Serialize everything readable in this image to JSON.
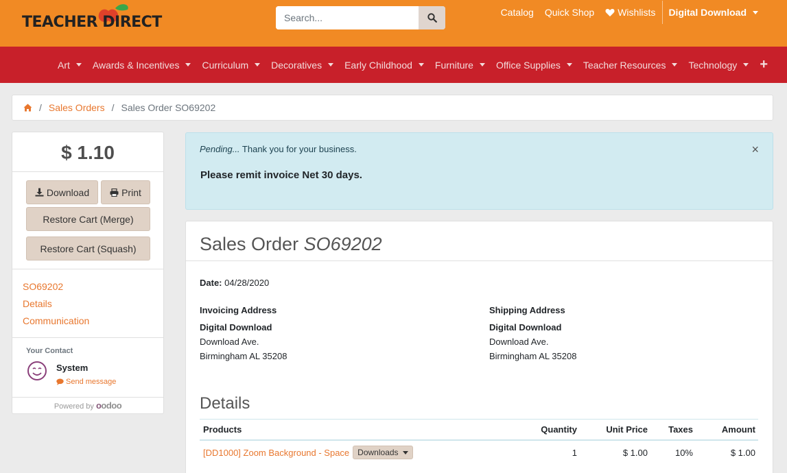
{
  "brand": {
    "name": "TEACHER DIRECT"
  },
  "search": {
    "placeholder": "Search..."
  },
  "top_links": {
    "catalog": "Catalog",
    "quick_shop": "Quick Shop",
    "wishlists": "Wishlists",
    "account": "Digital Download"
  },
  "nav": {
    "items": [
      "Art",
      "Awards & Incentives",
      "Curriculum",
      "Decoratives",
      "Early Childhood",
      "Furniture",
      "Office Supplies",
      "Teacher Resources",
      "Technology"
    ]
  },
  "breadcrumb": {
    "sales_orders": "Sales Orders",
    "current": "Sales Order SO69202"
  },
  "sidebar": {
    "amount": "$ 1.10",
    "download": "Download",
    "print": "Print",
    "restore_merge": "Restore Cart (Merge)",
    "restore_squash": "Restore Cart (Squash)",
    "links": [
      "SO69202",
      "Details",
      "Communication"
    ],
    "contact_label": "Your Contact",
    "contact_name": "System",
    "send_message": "Send message",
    "powered_by": "Powered by",
    "odoo": "odoo"
  },
  "alert": {
    "status": "Pending...",
    "thanks": " Thank you for your business.",
    "remit": "Please remit invoice Net 30 days.",
    "close": "×"
  },
  "order": {
    "title_prefix": "Sales Order ",
    "title_number": "SO69202",
    "date_label": "Date:",
    "date_value": "04/28/2020",
    "invoicing": {
      "heading": "Invoicing Address",
      "name": "Digital Download",
      "street": "Download Ave.",
      "city": "Birmingham AL 35208"
    },
    "shipping": {
      "heading": "Shipping Address",
      "name": "Digital Download",
      "street": "Download Ave.",
      "city": "Birmingham AL 35208"
    },
    "details_title": "Details",
    "table": {
      "headers": {
        "products": "Products",
        "quantity": "Quantity",
        "unit_price": "Unit Price",
        "taxes": "Taxes",
        "amount": "Amount"
      },
      "rows": [
        {
          "product": "[DD1000] Zoom Background - Space",
          "downloads": "Downloads",
          "quantity": "1",
          "unit_price": "$ 1.00",
          "taxes": "10%",
          "amount": "$ 1.00"
        }
      ]
    }
  },
  "colors": {
    "orange": "#f18a24",
    "red": "#c8202a",
    "link": "#e8772e",
    "alert_bg": "#d2ebf1"
  }
}
